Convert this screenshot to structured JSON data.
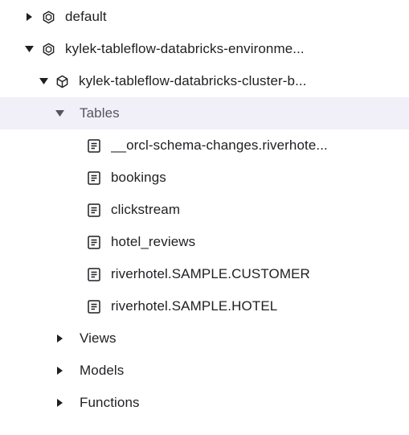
{
  "tree": {
    "default": {
      "label": "default",
      "icon": "database-icon",
      "expanded": false
    },
    "environment": {
      "label": "kylek-tableflow-databricks-environme...",
      "icon": "database-icon",
      "expanded": true
    },
    "cluster": {
      "label": "kylek-tableflow-databricks-cluster-b...",
      "icon": "cube-icon",
      "expanded": true
    },
    "tables": {
      "label": "Tables",
      "expanded": true,
      "items": [
        {
          "label": "__orcl-schema-changes.riverhote...",
          "icon": "table-icon"
        },
        {
          "label": "bookings",
          "icon": "table-icon"
        },
        {
          "label": "clickstream",
          "icon": "table-icon"
        },
        {
          "label": "hotel_reviews",
          "icon": "table-icon"
        },
        {
          "label": "riverhotel.SAMPLE.CUSTOMER",
          "icon": "table-icon"
        },
        {
          "label": "riverhotel.SAMPLE.HOTEL",
          "icon": "table-icon"
        }
      ]
    },
    "views": {
      "label": "Views",
      "expanded": false
    },
    "models": {
      "label": "Models",
      "expanded": false
    },
    "functions": {
      "label": "Functions",
      "expanded": false
    }
  },
  "colors": {
    "selected_row_bg": "#f1f0f8",
    "text": "#1f1f24",
    "muted_text": "#55555f",
    "icon": "#1f1f24"
  }
}
